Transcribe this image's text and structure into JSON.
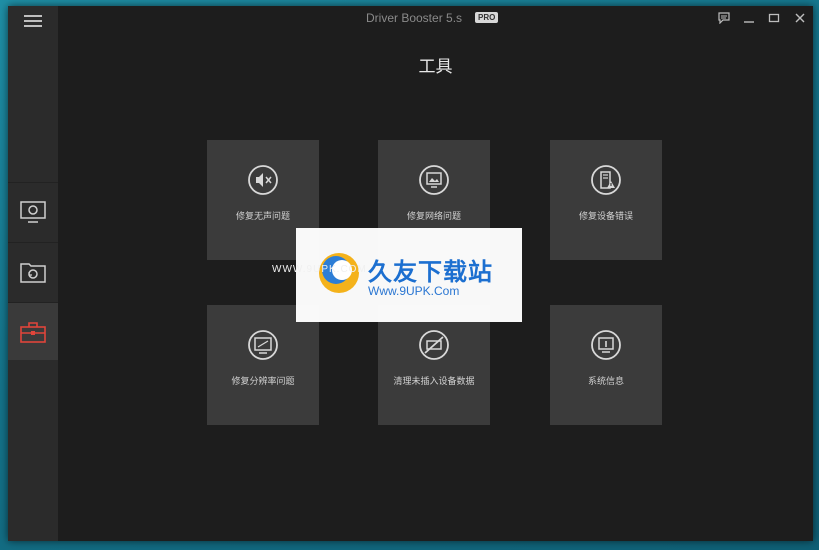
{
  "titlebar": {
    "app_title": "Driver Booster 5.s",
    "badge": "PRO",
    "icons": [
      "feedback-icon",
      "minimize-icon",
      "maximize-icon",
      "close-icon"
    ]
  },
  "sidebar": {
    "items": [
      {
        "name": "scan",
        "icon": "monitor-scan-icon"
      },
      {
        "name": "rescue",
        "icon": "restore-icon"
      },
      {
        "name": "tools",
        "icon": "toolbox-icon",
        "active": true
      }
    ]
  },
  "main": {
    "title": "工具",
    "tiles": [
      {
        "label": "修复无声问题",
        "icon": "mute-speaker-icon"
      },
      {
        "label": "修复网络问题",
        "icon": "network-icon"
      },
      {
        "label": "修复设备错误",
        "icon": "device-warning-icon"
      },
      {
        "label": "修复分辨率问题",
        "icon": "resolution-icon"
      },
      {
        "label": "清理未插入设备数据",
        "icon": "no-device-icon"
      },
      {
        "label": "系统信息",
        "icon": "system-info-icon"
      }
    ]
  },
  "watermark": {
    "brand": "久友下载站",
    "url": "Www.9UPK.Com",
    "side_text": "WWW.9UPK.COM"
  },
  "colors": {
    "accent_active": "#e0453a",
    "tile_bg": "#3b3b3b",
    "window_bg": "#1d1d1d",
    "sidebar_bg": "#2b2b2b",
    "desktop": "#15758c"
  }
}
